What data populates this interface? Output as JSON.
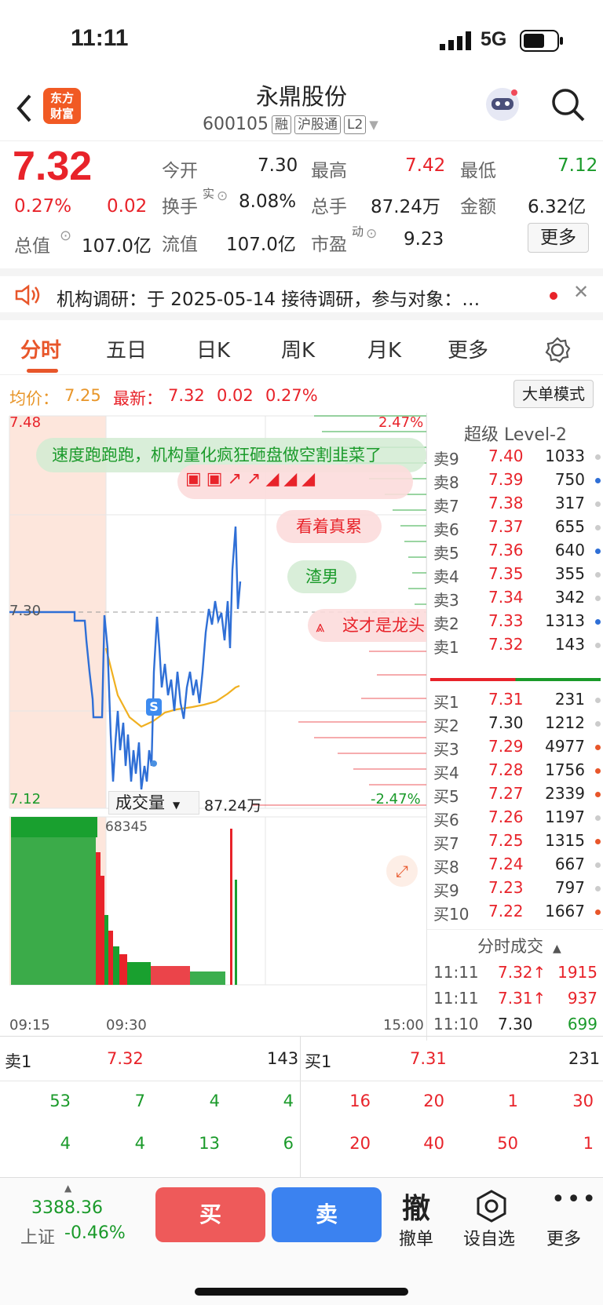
{
  "status": {
    "time": "11:11",
    "network": "5G"
  },
  "header": {
    "title": "永鼎股份",
    "code": "600105",
    "tags": [
      "融",
      "沪股通",
      "L2"
    ],
    "logo_line1": "东方",
    "logo_line2": "财富"
  },
  "quote": {
    "price": "7.32",
    "pct": "0.27%",
    "chg": "0.02",
    "f": [
      {
        "l": "今开",
        "v": "7.30"
      },
      {
        "l": "最高",
        "v": "7.42"
      },
      {
        "l": "最低",
        "v": "7.12"
      },
      {
        "l": "换手",
        "v": "8.08%"
      },
      {
        "l": "总手",
        "v": "87.24万"
      },
      {
        "l": "金额",
        "v": "6.32亿"
      },
      {
        "l": "总值",
        "v": "107.0亿"
      },
      {
        "l": "流值",
        "v": "107.0亿"
      },
      {
        "l": "市盈",
        "v": "9.23"
      }
    ],
    "sup_shi": "实",
    "sup_dong": "动",
    "more": "更多"
  },
  "notice": {
    "text": "机构调研：于 2025-05-14 接待调研，参与对象：…"
  },
  "tabs": [
    "分时",
    "五日",
    "日K",
    "周K",
    "月K",
    "更多"
  ],
  "legend": {
    "avg_label": "均价：",
    "avg": "7.25",
    "last_label": "最新：",
    "last": "7.32",
    "chg": "0.02",
    "pct": "0.27%",
    "mode": "大单模式"
  },
  "chart": {
    "ymax": "7.48",
    "ymid": "7.30",
    "ymin": "7.12",
    "pmax": "2.47%",
    "pmin": "-2.47%",
    "comments": [
      "速度跑跑跑，机构量化疯狂砸盘做空割韭菜了",
      "看着真累",
      "渣男",
      "这才是龙头"
    ],
    "vol_label": "成交量",
    "vol_total": "87.24万",
    "vol_max": "68345",
    "t0": "09:15",
    "t1": "09:30",
    "t2": "15:00",
    "marker": "S"
  },
  "orderbook": {
    "title": "超级 Level-2",
    "asks": [
      [
        "卖9",
        "7.40",
        "1033"
      ],
      [
        "卖8",
        "7.39",
        "750"
      ],
      [
        "卖7",
        "7.38",
        "317"
      ],
      [
        "卖6",
        "7.37",
        "655"
      ],
      [
        "卖5",
        "7.36",
        "640"
      ],
      [
        "卖4",
        "7.35",
        "355"
      ],
      [
        "卖3",
        "7.34",
        "342"
      ],
      [
        "卖2",
        "7.33",
        "1313"
      ],
      [
        "卖1",
        "7.32",
        "143"
      ]
    ],
    "bids": [
      [
        "买1",
        "7.31",
        "231"
      ],
      [
        "买2",
        "7.30",
        "1212"
      ],
      [
        "买3",
        "7.29",
        "4977"
      ],
      [
        "买4",
        "7.28",
        "1756"
      ],
      [
        "买5",
        "7.27",
        "2339"
      ],
      [
        "买6",
        "7.26",
        "1197"
      ],
      [
        "买7",
        "7.25",
        "1315"
      ],
      [
        "买8",
        "7.24",
        "667"
      ],
      [
        "买9",
        "7.23",
        "797"
      ],
      [
        "买10",
        "7.22",
        "1667"
      ]
    ],
    "ticks_title": "分时成交",
    "ticks": [
      [
        "11:11",
        "7.32↑",
        "1915"
      ],
      [
        "11:11",
        "7.31↑",
        "937"
      ],
      [
        "11:10",
        "7.30",
        "699"
      ]
    ]
  },
  "queue": {
    "ask_label": "卖1",
    "ask_price": "7.32",
    "ask_vol": "143",
    "bid_label": "买1",
    "bid_price": "7.31",
    "bid_vol": "231",
    "ask_orders": [
      "53",
      "7",
      "4",
      "4",
      "4",
      "4",
      "13",
      "6"
    ],
    "bid_orders": [
      "16",
      "20",
      "1",
      "30",
      "20",
      "40",
      "50",
      "1"
    ]
  },
  "toolbar": {
    "index_val": "3388.36",
    "index_name": "上证",
    "index_pct": "-0.46%",
    "buy": "买",
    "sell": "卖",
    "cancel_icon": "撤",
    "cancel": "撤单",
    "fav": "设自选",
    "more": "更多"
  }
}
